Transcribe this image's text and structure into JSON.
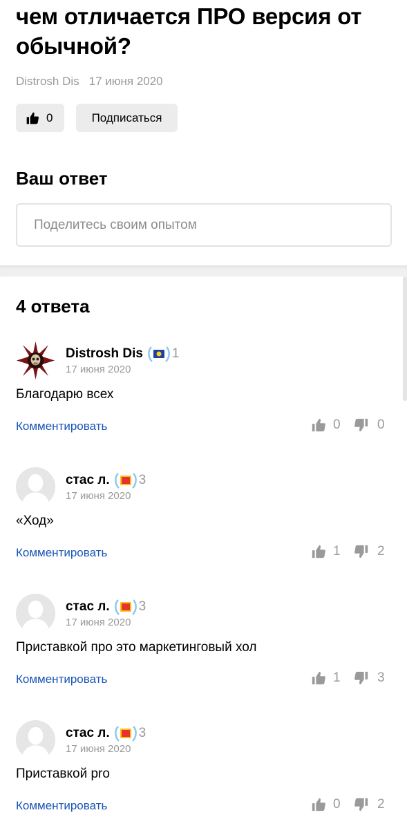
{
  "question": {
    "title": "чем отличается ПРО версия от обычной?",
    "author": "Distrosh Dis",
    "date": "17 июня 2020",
    "likes": "0",
    "subscribe_label": "Подписаться"
  },
  "your_answer": {
    "heading": "Ваш ответ",
    "placeholder": "Поделитесь своим опытом"
  },
  "answers_heading": "4 ответа",
  "comment_label": "Комментировать",
  "answers": [
    {
      "author": "Distrosh Dis",
      "level": "1",
      "date": "17 июня 2020",
      "text": "Благодарю всех",
      "up": "0",
      "down": "0",
      "badge": "blue"
    },
    {
      "author": "стас л.",
      "level": "3",
      "date": "17 июня 2020",
      "text": "«Ход»",
      "up": "1",
      "down": "2",
      "badge": "red"
    },
    {
      "author": "стас л.",
      "level": "3",
      "date": "17 июня 2020",
      "text": "Приставкой про это маркетинговый хол",
      "up": "1",
      "down": "3",
      "badge": "red"
    },
    {
      "author": "стас л.",
      "level": "3",
      "date": "17 июня 2020",
      "text": "Приставкой pro",
      "up": "0",
      "down": "2",
      "badge": "red"
    }
  ],
  "colors": {
    "link": "#1a55b5",
    "muted": "#999999",
    "button_bg": "#ececec",
    "badge_laurel": "#8fc7ef",
    "badge_blue": "#1f3fa8",
    "badge_red": "#e7332b"
  }
}
